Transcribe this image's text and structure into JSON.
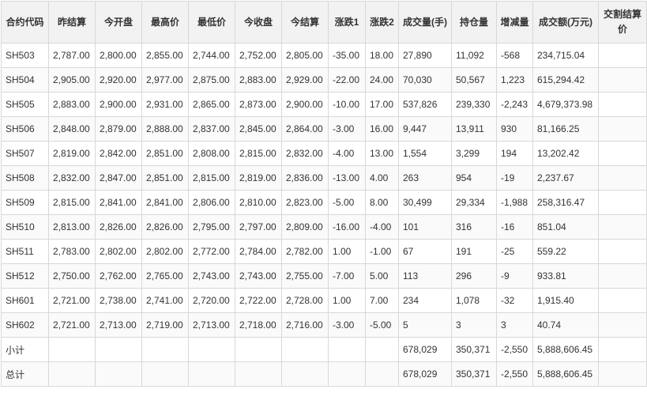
{
  "table": {
    "headers": [
      "合约代码",
      "昨结算",
      "今开盘",
      "最高价",
      "最低价",
      "今收盘",
      "今结算",
      "涨跌1",
      "涨跌2",
      "成交量(手)",
      "持仓量",
      "增减量",
      "成交额(万元)",
      "交割结算价"
    ],
    "rows": [
      [
        "SH503",
        "2,787.00",
        "2,800.00",
        "2,855.00",
        "2,744.00",
        "2,752.00",
        "2,805.00",
        "-35.00",
        "18.00",
        "27,890",
        "11,092",
        "-568",
        "234,715.04",
        ""
      ],
      [
        "SH504",
        "2,905.00",
        "2,920.00",
        "2,977.00",
        "2,875.00",
        "2,883.00",
        "2,929.00",
        "-22.00",
        "24.00",
        "70,030",
        "50,567",
        "1,223",
        "615,294.42",
        ""
      ],
      [
        "SH505",
        "2,883.00",
        "2,900.00",
        "2,931.00",
        "2,865.00",
        "2,873.00",
        "2,900.00",
        "-10.00",
        "17.00",
        "537,826",
        "239,330",
        "-2,243",
        "4,679,373.98",
        ""
      ],
      [
        "SH506",
        "2,848.00",
        "2,879.00",
        "2,888.00",
        "2,837.00",
        "2,845.00",
        "2,864.00",
        "-3.00",
        "16.00",
        "9,447",
        "13,911",
        "930",
        "81,166.25",
        ""
      ],
      [
        "SH507",
        "2,819.00",
        "2,842.00",
        "2,851.00",
        "2,808.00",
        "2,815.00",
        "2,832.00",
        "-4.00",
        "13.00",
        "1,554",
        "3,299",
        "194",
        "13,202.42",
        ""
      ],
      [
        "SH508",
        "2,832.00",
        "2,847.00",
        "2,851.00",
        "2,815.00",
        "2,819.00",
        "2,836.00",
        "-13.00",
        "4.00",
        "263",
        "954",
        "-19",
        "2,237.67",
        ""
      ],
      [
        "SH509",
        "2,815.00",
        "2,841.00",
        "2,841.00",
        "2,806.00",
        "2,810.00",
        "2,823.00",
        "-5.00",
        "8.00",
        "30,499",
        "29,334",
        "-1,988",
        "258,316.47",
        ""
      ],
      [
        "SH510",
        "2,813.00",
        "2,826.00",
        "2,826.00",
        "2,795.00",
        "2,797.00",
        "2,809.00",
        "-16.00",
        "-4.00",
        "101",
        "316",
        "-16",
        "851.04",
        ""
      ],
      [
        "SH511",
        "2,783.00",
        "2,802.00",
        "2,802.00",
        "2,772.00",
        "2,784.00",
        "2,782.00",
        "1.00",
        "-1.00",
        "67",
        "191",
        "-25",
        "559.22",
        ""
      ],
      [
        "SH512",
        "2,750.00",
        "2,762.00",
        "2,765.00",
        "2,743.00",
        "2,743.00",
        "2,755.00",
        "-7.00",
        "5.00",
        "113",
        "296",
        "-9",
        "933.81",
        ""
      ],
      [
        "SH601",
        "2,721.00",
        "2,738.00",
        "2,741.00",
        "2,720.00",
        "2,722.00",
        "2,728.00",
        "1.00",
        "7.00",
        "234",
        "1,078",
        "-32",
        "1,915.40",
        ""
      ],
      [
        "SH602",
        "2,721.00",
        "2,713.00",
        "2,719.00",
        "2,713.00",
        "2,718.00",
        "2,716.00",
        "-3.00",
        "-5.00",
        "5",
        "3",
        "3",
        "40.74",
        ""
      ],
      [
        "小计",
        "",
        "",
        "",
        "",
        "",
        "",
        "",
        "",
        "678,029",
        "350,371",
        "-2,550",
        "5,888,606.45",
        ""
      ],
      [
        "总计",
        "",
        "",
        "",
        "",
        "",
        "",
        "",
        "",
        "678,029",
        "350,371",
        "-2,550",
        "5,888,606.45",
        ""
      ]
    ]
  }
}
